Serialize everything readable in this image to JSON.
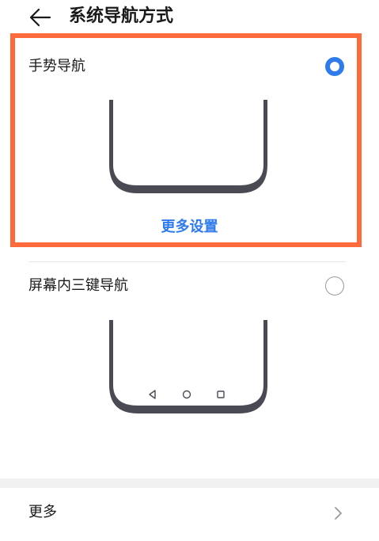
{
  "header": {
    "back_icon": "arrow-left-icon",
    "title": "系统导航方式"
  },
  "options": [
    {
      "label": "手势导航",
      "selected": true,
      "more_settings_label": "更多设置"
    },
    {
      "label": "屏幕内三键导航",
      "selected": false,
      "nav_keys": [
        "back-triangle-icon",
        "home-circle-icon",
        "recent-square-icon"
      ]
    }
  ],
  "more_row": {
    "label": "更多",
    "chevron_icon": "chevron-right-icon"
  },
  "colors": {
    "accent": "#2f7bee",
    "highlight_border": "#ff6a3d",
    "outline": "#4a4a55"
  }
}
